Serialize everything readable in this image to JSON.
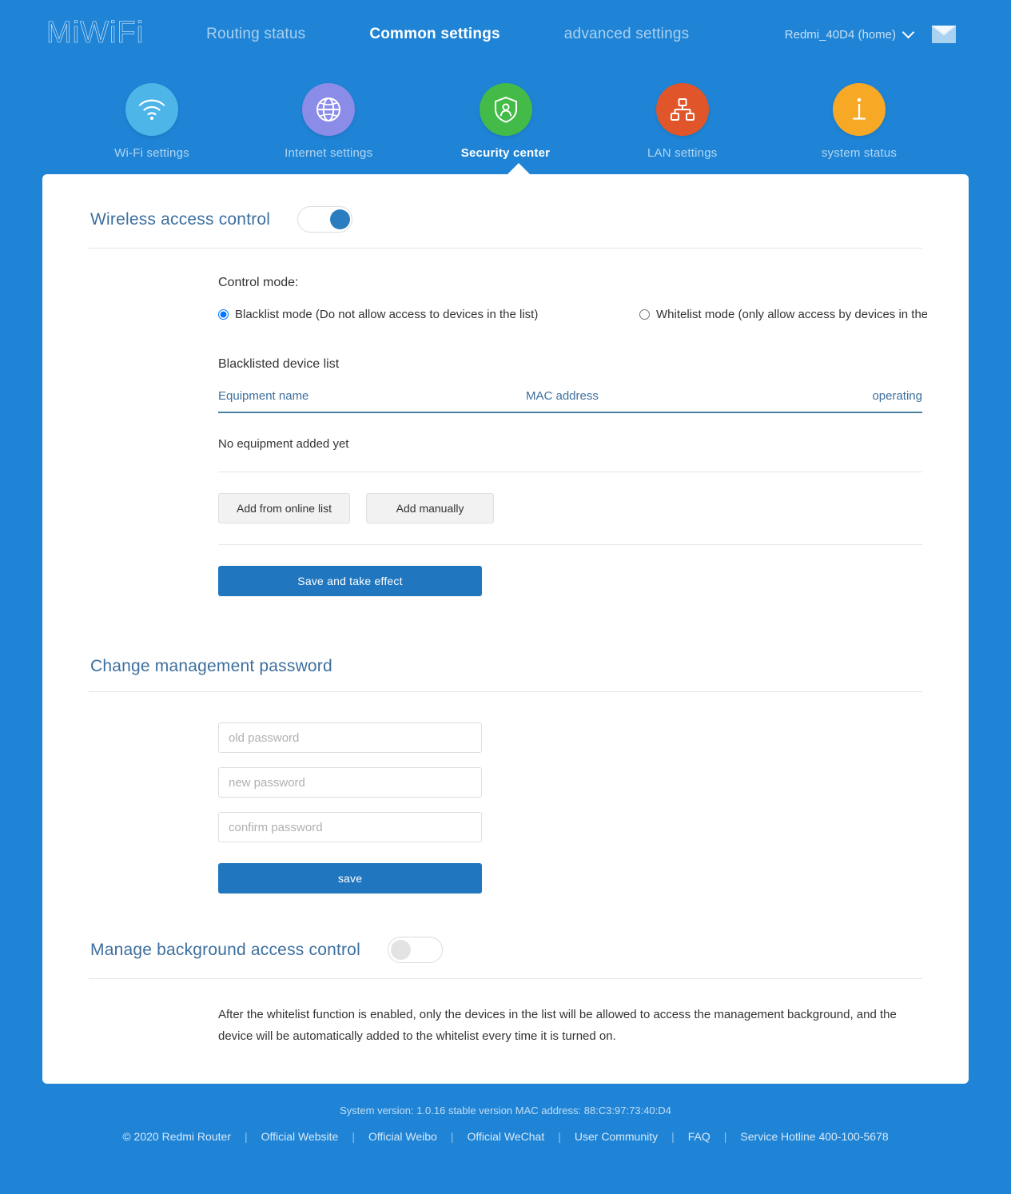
{
  "header": {
    "logo": "MiWiFi",
    "nav": [
      {
        "label": "Routing status",
        "active": false
      },
      {
        "label": "Common settings",
        "active": true
      },
      {
        "label": "advanced settings",
        "active": false
      }
    ],
    "router_name": "Redmi_40D4 (home)",
    "chevron_icon": "chevron-down-icon",
    "mail_icon": "mail-icon"
  },
  "iconnav": [
    {
      "label": "Wi-Fi settings",
      "icon": "wifi-icon",
      "color": "#4db5e8",
      "active": false
    },
    {
      "label": "Internet settings",
      "icon": "globe-icon",
      "color": "#8b8ce8",
      "active": false
    },
    {
      "label": "Security center",
      "icon": "shield-user-icon",
      "color": "#44bb48",
      "active": true
    },
    {
      "label": "LAN settings",
      "icon": "network-topology-icon",
      "color": "#e0562a",
      "active": false
    },
    {
      "label": "system status",
      "icon": "info-icon",
      "color": "#f7a925",
      "active": false
    }
  ],
  "wireless_access": {
    "title": "Wireless access control",
    "toggle_state": "on",
    "control_mode_label": "Control mode:",
    "modes": [
      {
        "label": "Blacklist mode (Do not allow access to devices in the list)",
        "selected": true
      },
      {
        "label": "Whitelist mode (only allow access by devices in the list)",
        "selected": false
      }
    ],
    "list_title": "Blacklisted device list",
    "table": {
      "headers": [
        "Equipment name",
        "MAC address",
        "operating"
      ],
      "rows": [],
      "empty_text": "No equipment added yet"
    },
    "buttons": {
      "add_online": "Add from online list",
      "add_manual": "Add manually",
      "save": "Save and take effect"
    }
  },
  "password_section": {
    "title": "Change management password",
    "old_placeholder": "old password",
    "new_placeholder": "new password",
    "confirm_placeholder": "confirm password",
    "old_value": "",
    "new_value": "",
    "confirm_value": "",
    "save_label": "save"
  },
  "background_access": {
    "title": "Manage background access control",
    "toggle_state": "off",
    "note": "After the whitelist function is enabled, only the devices in the list will be allowed to access the management background, and the device will be automatically added to the whitelist every time it is turned on."
  },
  "footer": {
    "system_version": "System version: 1.0.16 stable version MAC address: 88:C3:97:73:40:D4",
    "copyright": "© 2020 Redmi Router",
    "links": [
      "Official Website",
      "Official Weibo",
      "Official WeChat",
      "User Community",
      "FAQ",
      "Service Hotline 400-100-5678"
    ],
    "separator": "|"
  },
  "colors": {
    "page_bg": "#1f84d6",
    "primary_button": "#2077bf",
    "section_title": "#3d6f9e",
    "table_header": "#3d6f9e"
  }
}
